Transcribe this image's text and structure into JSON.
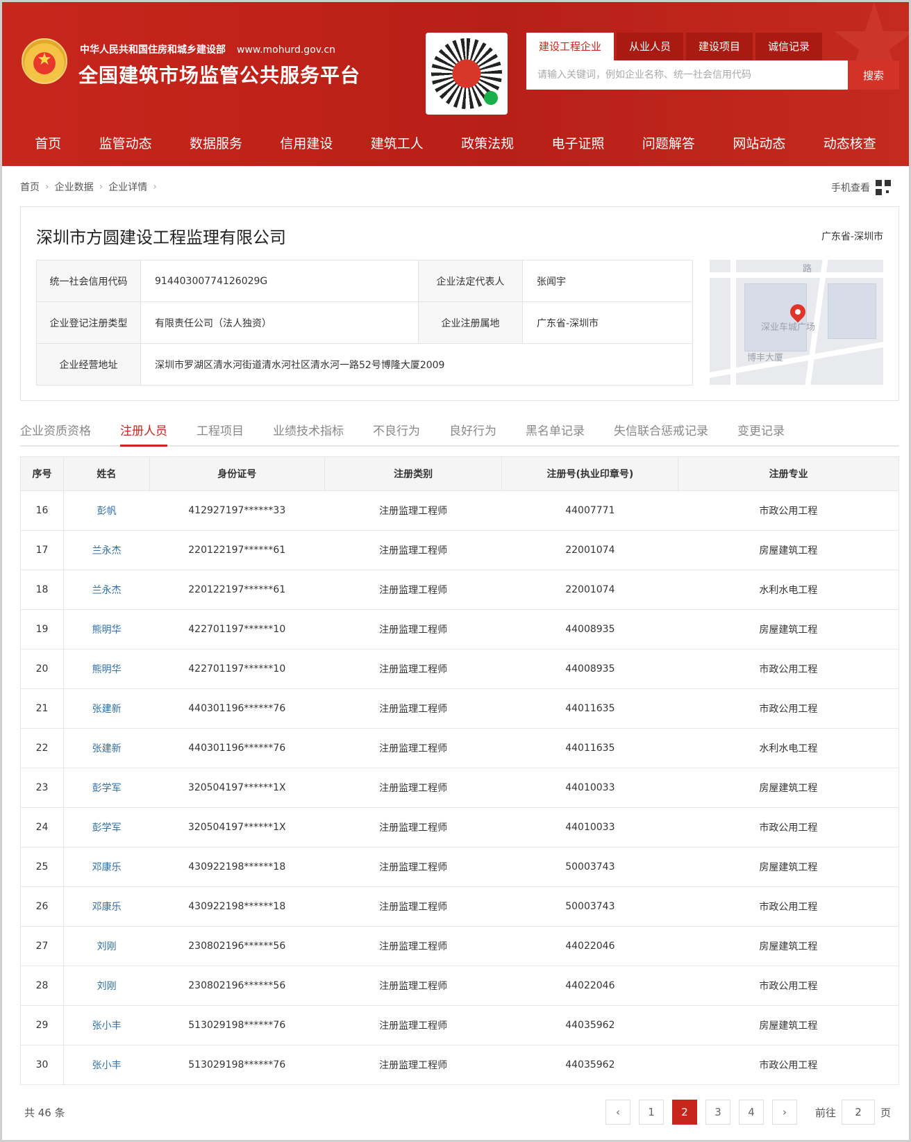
{
  "header": {
    "ministry": "中华人民共和国住房和城乡建设部",
    "url": "www.mohurd.gov.cn",
    "title": "全国建筑市场监管公共服务平台",
    "search_tabs": [
      "建设工程企业",
      "从业人员",
      "建设项目",
      "诚信记录"
    ],
    "search_placeholder": "请输入关键词，例如企业名称、统一社会信用代码",
    "search_button": "搜索"
  },
  "nav": [
    "首页",
    "监管动态",
    "数据服务",
    "信用建设",
    "建筑工人",
    "政策法规",
    "电子证照",
    "问题解答",
    "网站动态",
    "动态核查"
  ],
  "breadcrumb": [
    "首页",
    "企业数据",
    "企业详情"
  ],
  "mobile_view": "手机查看",
  "company": {
    "name": "深圳市方圆建设工程监理有限公司",
    "region": "广东省-深圳市",
    "credit_code_label": "统一社会信用代码",
    "credit_code": "91440300774126029G",
    "legal_rep_label": "企业法定代表人",
    "legal_rep": "张闻宇",
    "reg_type_label": "企业登记注册类型",
    "reg_type": "有限责任公司（法人独资）",
    "reg_place_label": "企业注册属地",
    "reg_place": "广东省-深圳市",
    "address_label": "企业经营地址",
    "address": "深圳市罗湖区清水河街道清水河社区清水河一路52号博隆大厦2009",
    "map_labels": [
      "深业车城广场",
      "博丰大厦",
      "路"
    ]
  },
  "tabs": [
    "企业资质资格",
    "注册人员",
    "工程项目",
    "业绩技术指标",
    "不良行为",
    "良好行为",
    "黑名单记录",
    "失信联合惩戒记录",
    "变更记录"
  ],
  "table": {
    "headers": [
      "序号",
      "姓名",
      "身份证号",
      "注册类别",
      "注册号(执业印章号)",
      "注册专业"
    ],
    "rows": [
      [
        "16",
        "彭帆",
        "412927197******33",
        "注册监理工程师",
        "44007771",
        "市政公用工程"
      ],
      [
        "17",
        "兰永杰",
        "220122197******61",
        "注册监理工程师",
        "22001074",
        "房屋建筑工程"
      ],
      [
        "18",
        "兰永杰",
        "220122197******61",
        "注册监理工程师",
        "22001074",
        "水利水电工程"
      ],
      [
        "19",
        "熊明华",
        "422701197******10",
        "注册监理工程师",
        "44008935",
        "房屋建筑工程"
      ],
      [
        "20",
        "熊明华",
        "422701197******10",
        "注册监理工程师",
        "44008935",
        "市政公用工程"
      ],
      [
        "21",
        "张建新",
        "440301196******76",
        "注册监理工程师",
        "44011635",
        "市政公用工程"
      ],
      [
        "22",
        "张建新",
        "440301196******76",
        "注册监理工程师",
        "44011635",
        "水利水电工程"
      ],
      [
        "23",
        "彭学军",
        "320504197******1X",
        "注册监理工程师",
        "44010033",
        "房屋建筑工程"
      ],
      [
        "24",
        "彭学军",
        "320504197******1X",
        "注册监理工程师",
        "44010033",
        "市政公用工程"
      ],
      [
        "25",
        "邓康乐",
        "430922198******18",
        "注册监理工程师",
        "50003743",
        "房屋建筑工程"
      ],
      [
        "26",
        "邓康乐",
        "430922198******18",
        "注册监理工程师",
        "50003743",
        "市政公用工程"
      ],
      [
        "27",
        "刘刚",
        "230802196******56",
        "注册监理工程师",
        "44022046",
        "房屋建筑工程"
      ],
      [
        "28",
        "刘刚",
        "230802196******56",
        "注册监理工程师",
        "44022046",
        "市政公用工程"
      ],
      [
        "29",
        "张小丰",
        "513029198******76",
        "注册监理工程师",
        "44035962",
        "房屋建筑工程"
      ],
      [
        "30",
        "张小丰",
        "513029198******76",
        "注册监理工程师",
        "44035962",
        "市政公用工程"
      ]
    ]
  },
  "pagination": {
    "total": "共 46 条",
    "pages": [
      "1",
      "2",
      "3",
      "4"
    ],
    "current": "2",
    "prev": "‹",
    "next": "›",
    "goto_prefix": "前往",
    "goto_value": "2",
    "goto_suffix": "页"
  }
}
